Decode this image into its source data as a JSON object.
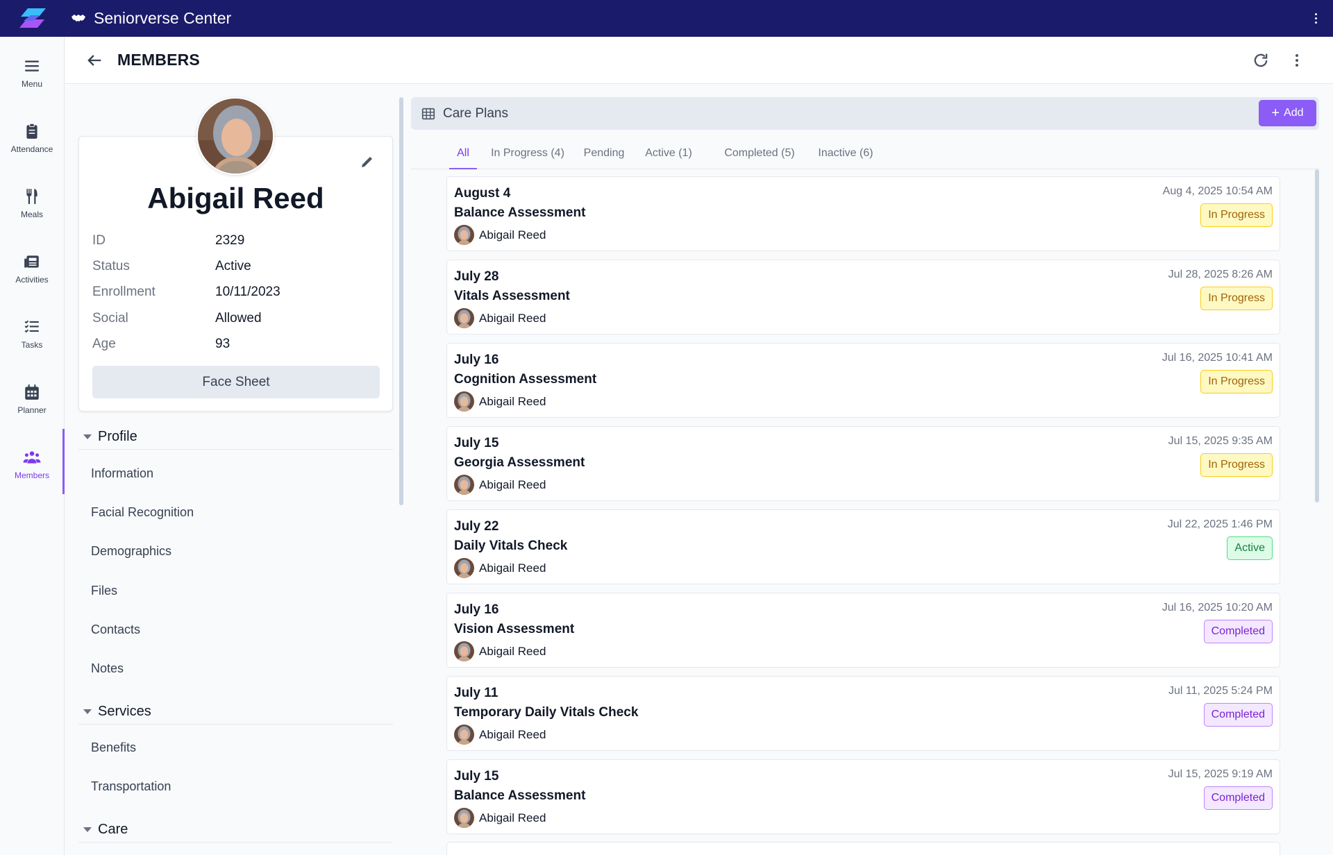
{
  "app": {
    "title": "Seniorverse Center"
  },
  "rail": [
    {
      "label": "Menu",
      "icon": "menu-icon"
    },
    {
      "label": "Attendance",
      "icon": "clipboard-icon"
    },
    {
      "label": "Meals",
      "icon": "utensils-icon"
    },
    {
      "label": "Activities",
      "icon": "newspaper-icon"
    },
    {
      "label": "Tasks",
      "icon": "checklist-icon"
    },
    {
      "label": "Planner",
      "icon": "calendar-icon"
    },
    {
      "label": "Members",
      "icon": "people-icon",
      "active": true
    }
  ],
  "header": {
    "title": "MEMBERS"
  },
  "member": {
    "name": "Abigail Reed",
    "fields": [
      {
        "label": "ID",
        "value": "2329"
      },
      {
        "label": "Status",
        "value": "Active"
      },
      {
        "label": "Enrollment",
        "value": "10/11/2023"
      },
      {
        "label": "Social",
        "value": "Allowed"
      },
      {
        "label": "Age",
        "value": "93"
      }
    ],
    "face_sheet_label": "Face Sheet"
  },
  "nav": {
    "profile": {
      "title": "Profile",
      "items": [
        "Information",
        "Facial Recognition",
        "Demographics",
        "Files",
        "Contacts",
        "Notes"
      ]
    },
    "services": {
      "title": "Services",
      "items": [
        "Benefits",
        "Transportation"
      ]
    },
    "care": {
      "title": "Care"
    }
  },
  "care_plans": {
    "title": "Care Plans",
    "add_label": "Add",
    "tabs": [
      "All",
      "In Progress (4)",
      "Pending",
      "Active (1)",
      "Completed (5)",
      "Inactive (6)"
    ],
    "active_tab": "All",
    "items": [
      {
        "date": "August 4",
        "title": "Balance Assessment",
        "person": "Abigail Reed",
        "timestamp": "Aug 4, 2025 10:54 AM",
        "status": "In Progress"
      },
      {
        "date": "July 28",
        "title": "Vitals Assessment",
        "person": "Abigail Reed",
        "timestamp": "Jul 28, 2025 8:26 AM",
        "status": "In Progress"
      },
      {
        "date": "July 16",
        "title": "Cognition Assessment",
        "person": "Abigail Reed",
        "timestamp": "Jul 16, 2025 10:41 AM",
        "status": "In Progress"
      },
      {
        "date": "July 15",
        "title": "Georgia Assessment",
        "person": "Abigail Reed",
        "timestamp": "Jul 15, 2025 9:35 AM",
        "status": "In Progress"
      },
      {
        "date": "July 22",
        "title": "Daily Vitals Check",
        "person": "Abigail Reed",
        "timestamp": "Jul 22, 2025 1:46 PM",
        "status": "Active"
      },
      {
        "date": "July 16",
        "title": "Vision Assessment",
        "person": "Abigail Reed",
        "timestamp": "Jul 16, 2025 10:20 AM",
        "status": "Completed"
      },
      {
        "date": "July 11",
        "title": "Temporary Daily Vitals Check",
        "person": "Abigail Reed",
        "timestamp": "Jul 11, 2025 5:24 PM",
        "status": "Completed"
      },
      {
        "date": "July 15",
        "title": "Balance Assessment",
        "person": "Abigail Reed",
        "timestamp": "Jul 15, 2025 9:19 AM",
        "status": "Completed"
      }
    ]
  },
  "colors": {
    "topbar": "#1b1b6b",
    "accent": "#8b5cf6",
    "in_progress_bg": "#fef9c3",
    "in_progress_border": "#facc15",
    "in_progress_text": "#a16207",
    "active_bg": "#dcfce7",
    "active_border": "#4ade80",
    "active_text": "#15803d",
    "completed_bg": "#f3e8ff",
    "completed_border": "#c084fc",
    "completed_text": "#7e22ce"
  }
}
